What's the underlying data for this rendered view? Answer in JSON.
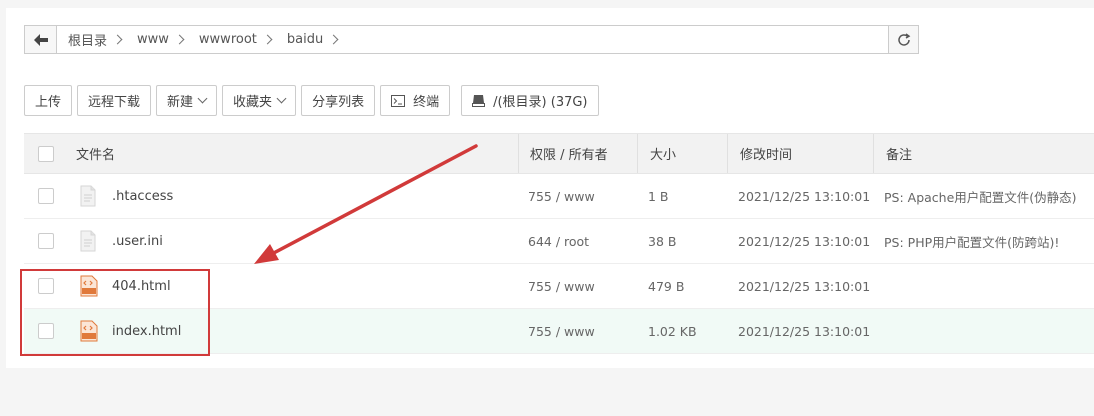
{
  "path": {
    "crumbs": [
      "根目录",
      "www",
      "wwwroot",
      "baidu"
    ]
  },
  "toolbar": {
    "upload": "上传",
    "remote_download": "远程下载",
    "new": "新建",
    "favorites": "收藏夹",
    "share_list": "分享列表",
    "terminal": "终端",
    "disk": "/(根目录) (37G)"
  },
  "table": {
    "headers": {
      "name": "文件名",
      "perm": "权限 / 所有者",
      "size": "大小",
      "mtime": "修改时间",
      "note": "备注"
    },
    "rows": [
      {
        "name": ".htaccess",
        "perm": "755 / www",
        "size": "1 B",
        "mtime": "2021/12/25 13:10:01",
        "note": "PS: Apache用户配置文件(伪静态)",
        "icon": "file-icon"
      },
      {
        "name": ".user.ini",
        "perm": "644 / root",
        "size": "38 B",
        "mtime": "2021/12/25 13:10:01",
        "note": "PS: PHP用户配置文件(防跨站)!",
        "icon": "file-icon"
      },
      {
        "name": "404.html",
        "perm": "755 / www",
        "size": "479 B",
        "mtime": "2021/12/25 13:10:01",
        "note": "",
        "icon": "html-file-icon"
      },
      {
        "name": "index.html",
        "perm": "755 / www",
        "size": "1.02 KB",
        "mtime": "2021/12/25 13:10:01",
        "note": "",
        "icon": "html-file-icon"
      }
    ]
  },
  "colors": {
    "annotation_red": "#d13a3a",
    "row_highlight": "#f1faf6",
    "html_icon_orange": "#e0793b"
  }
}
